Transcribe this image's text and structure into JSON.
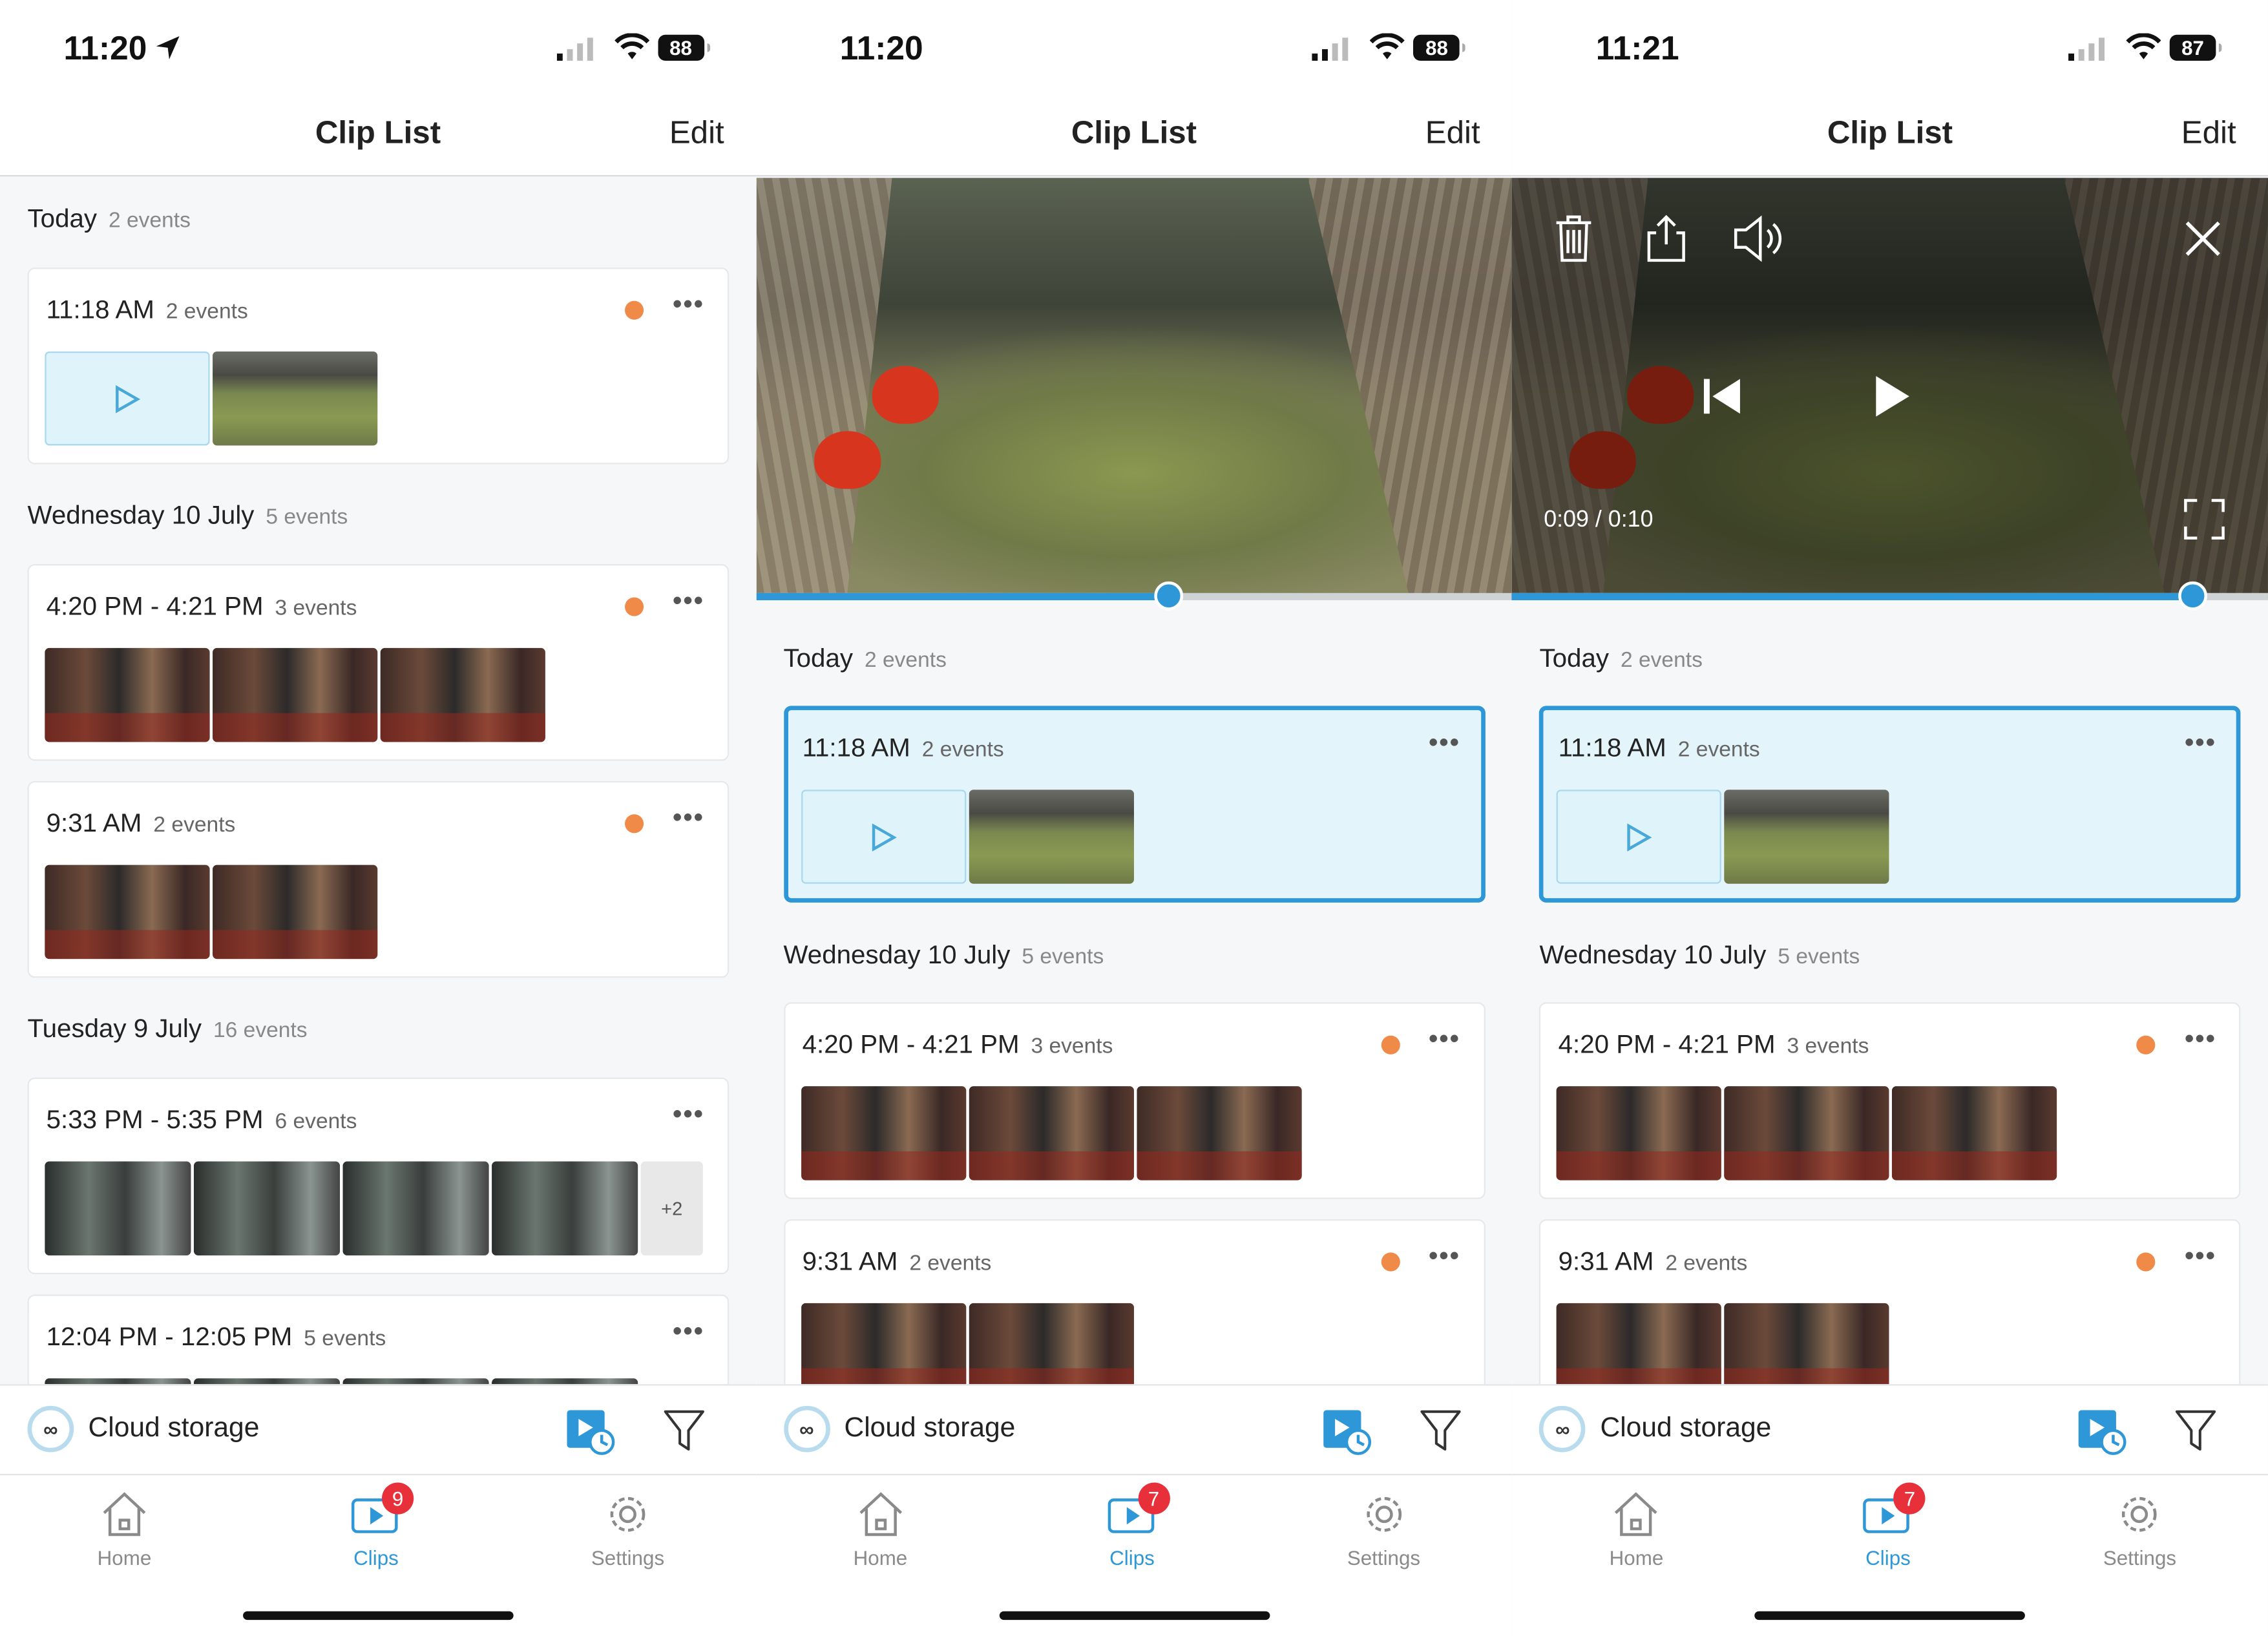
{
  "screens": [
    {
      "status": {
        "time": "11:20",
        "battery": "88",
        "has_location": true
      },
      "nav": {
        "title": "Clip List",
        "edit": "Edit"
      },
      "groups": [
        {
          "label": "Today",
          "count": "2 events",
          "cards": [
            {
              "time": "11:18 AM",
              "count": "2 events",
              "dot": true
            }
          ]
        },
        {
          "label": "Wednesday 10 July",
          "count": "5 events",
          "cards": [
            {
              "time": "4:20 PM - 4:21 PM",
              "count": "3 events",
              "dot": true
            },
            {
              "time": "9:31 AM",
              "count": "2 events",
              "dot": true
            }
          ]
        },
        {
          "label": "Tuesday 9 July",
          "count": "16 events",
          "cards": [
            {
              "time": "5:33 PM - 5:35 PM",
              "count": "6 events",
              "dot": false,
              "more_label": "+2"
            },
            {
              "time": "12:04 PM - 12:05 PM",
              "count": "5 events",
              "dot": false
            }
          ]
        }
      ],
      "cloud_label": "Cloud storage",
      "tabs": {
        "home": "Home",
        "clips": "Clips",
        "settings": "Settings",
        "badge": "9"
      }
    },
    {
      "status": {
        "time": "11:20",
        "battery": "88"
      },
      "nav": {
        "title": "Clip List",
        "edit": "Edit"
      },
      "video": {
        "progress": 0.546
      },
      "groups": [
        {
          "label": "Today",
          "count": "2 events",
          "cards": [
            {
              "time": "11:18 AM",
              "count": "2 events",
              "selected": true
            }
          ]
        },
        {
          "label": "Wednesday 10 July",
          "count": "5 events",
          "cards": [
            {
              "time": "4:20 PM - 4:21 PM",
              "count": "3 events",
              "dot": true
            },
            {
              "time": "9:31 AM",
              "count": "2 events",
              "dot": true
            }
          ]
        }
      ],
      "cloud_label": "Cloud storage",
      "tabs": {
        "home": "Home",
        "clips": "Clips",
        "settings": "Settings",
        "badge": "7"
      }
    },
    {
      "status": {
        "time": "11:21",
        "battery": "87"
      },
      "nav": {
        "title": "Clip List",
        "edit": "Edit"
      },
      "video": {
        "progress": 0.9,
        "time_readout": "0:09 / 0:10"
      },
      "groups": [
        {
          "label": "Today",
          "count": "2 events",
          "cards": [
            {
              "time": "11:18 AM",
              "count": "2 events",
              "selected": true
            }
          ]
        },
        {
          "label": "Wednesday 10 July",
          "count": "5 events",
          "cards": [
            {
              "time": "4:20 PM - 4:21 PM",
              "count": "3 events",
              "dot": true
            },
            {
              "time": "9:31 AM",
              "count": "2 events",
              "dot": true
            }
          ]
        }
      ],
      "cloud_label": "Cloud storage",
      "tabs": {
        "home": "Home",
        "clips": "Clips",
        "settings": "Settings",
        "badge": "7"
      }
    }
  ],
  "colors": {
    "accent": "#2e97d8",
    "event_dot": "#f08a48",
    "badge": "#e8303a",
    "selected_bg": "#e4f4fb"
  }
}
